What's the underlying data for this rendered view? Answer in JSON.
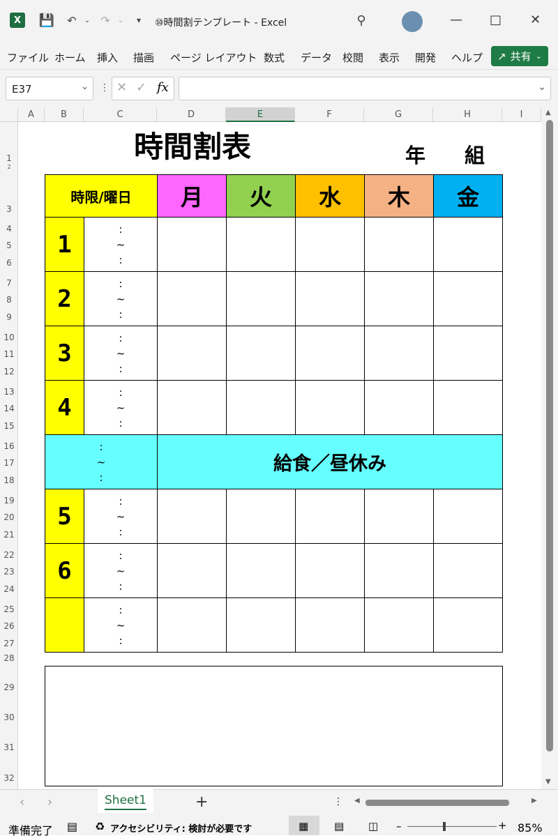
{
  "window": {
    "title": "⑩時間割テンプレート  -  Excel",
    "icons": [
      "excel-icon",
      "save-icon",
      "undo-icon",
      "redo-icon",
      "customize-icon",
      "search-icon",
      "avatar",
      "minimize-icon",
      "maximize-icon",
      "close-icon"
    ]
  },
  "menu": {
    "items": [
      "ファイル",
      "ホーム",
      "挿入",
      "描画",
      "ページ レイアウト",
      "数式",
      "データ",
      "校閲",
      "表示",
      "開発",
      "ヘルプ"
    ],
    "share_label": "共有"
  },
  "formula_bar": {
    "name_box": "E37",
    "formula": ""
  },
  "grid": {
    "columns": [
      "A",
      "B",
      "C",
      "D",
      "E",
      "F",
      "G",
      "H",
      "I"
    ],
    "selected_column": "E",
    "rows": [
      "1",
      "2",
      "3",
      "4",
      "5",
      "6",
      "7",
      "8",
      "9",
      "10",
      "11",
      "12",
      "13",
      "14",
      "15",
      "16",
      "17",
      "18",
      "19",
      "20",
      "21",
      "22",
      "23",
      "24",
      "25",
      "26",
      "27",
      "28",
      "29",
      "30",
      "31",
      "32"
    ]
  },
  "timetable": {
    "title": "時間割表",
    "year_label": "年",
    "class_label": "組",
    "corner_header": "時限/曜日",
    "days": [
      {
        "label": "月",
        "color": "#ff66ff"
      },
      {
        "label": "火",
        "color": "#92d050"
      },
      {
        "label": "水",
        "color": "#ffc000"
      },
      {
        "label": "木",
        "color": "#f4b183"
      },
      {
        "label": "金",
        "color": "#00b0f0"
      }
    ],
    "periods": [
      "1",
      "2",
      "3",
      "4",
      "5",
      "6",
      ""
    ],
    "time_colon": ":",
    "time_tilde": "~",
    "lunch_label": "給食／昼休み",
    "period_color": "#ffff00",
    "lunch_color": "#66ffff"
  },
  "tabs": {
    "sheet": "Sheet1",
    "add": "+"
  },
  "status": {
    "ready": "準備完了",
    "accessibility": "アクセシビリティ: 検討が必要です",
    "zoom": "85%"
  }
}
